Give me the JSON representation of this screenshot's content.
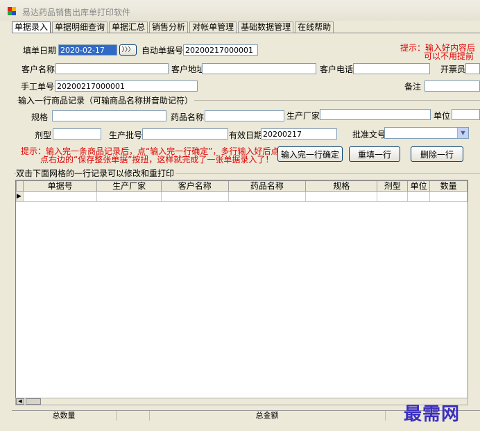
{
  "window": {
    "title": "易达药品销售出库单打印软件"
  },
  "tabs": [
    {
      "label": "单据录入"
    },
    {
      "label": "单据明细查询"
    },
    {
      "label": "单据汇总"
    },
    {
      "label": "销售分析"
    },
    {
      "label": "对帐单管理"
    },
    {
      "label": "基础数据管理"
    },
    {
      "label": "在线帮助"
    }
  ],
  "header": {
    "date_label": "填单日期",
    "date_value": "2020-02-17",
    "date_button": "〉〉〉",
    "auto_no_label": "自动单据号",
    "auto_no_value": "20200217000001",
    "tip_line1": "提示：输入好内容后",
    "tip_line2": "可以不用提前",
    "customer_name_label": "客户名称",
    "customer_name_value": "",
    "customer_address_label": "客户地址",
    "customer_address_value": "",
    "customer_phone_label": "客户电话",
    "customer_phone_value": "",
    "issuer_label": "开票员",
    "issuer_value": "",
    "manual_no_label": "手工单号",
    "manual_no_value": "20200217000001",
    "note_label": "备注",
    "note_value": ""
  },
  "item_entry": {
    "group_title": "输入一行商品记录（可输商品名称拼音助记符）",
    "spec_label": "规格",
    "spec_value": "",
    "drug_name_label": "药品名称",
    "drug_name_value": "",
    "manufacturer_label": "生产厂家",
    "manufacturer_value": "",
    "unit_label": "单位",
    "unit_value": "",
    "form_label": "剂型",
    "form_value": "",
    "batch_label": "生产批号",
    "batch_value": "",
    "expiry_label": "有效日期",
    "expiry_value": "20200217",
    "approval_label": "批准文号",
    "approval_value": "",
    "tip_line1": "提示：输入完一条商品记录后，点“输入完一行确定”，多行输入好后点",
    "tip_line2": "点右边的“保存整张单据”按扭，这样就完成了一张单据录入了！",
    "confirm_button": "输入完一行确定",
    "refill_button": "重填一行",
    "delete_button": "删除一行"
  },
  "grid": {
    "group_title": "双击下面网格的一行记录可以修改和重打印",
    "columns": [
      "单据号",
      "生产厂家",
      "客户名称",
      "药品名称",
      "规格",
      "剂型",
      "单位",
      "数量"
    ],
    "rows": [
      {
        "indicator": "▶",
        "cells": [
          "",
          "",
          "",
          "",
          "",
          "",
          "",
          ""
        ]
      }
    ]
  },
  "status": {
    "total_qty_label": "总数量",
    "total_amount_label": "总金额"
  },
  "watermark": "最需网",
  "colors": {
    "tip_red": "#e00000",
    "selection_blue": "#3169c6",
    "watermark": "#3c2fc0"
  }
}
